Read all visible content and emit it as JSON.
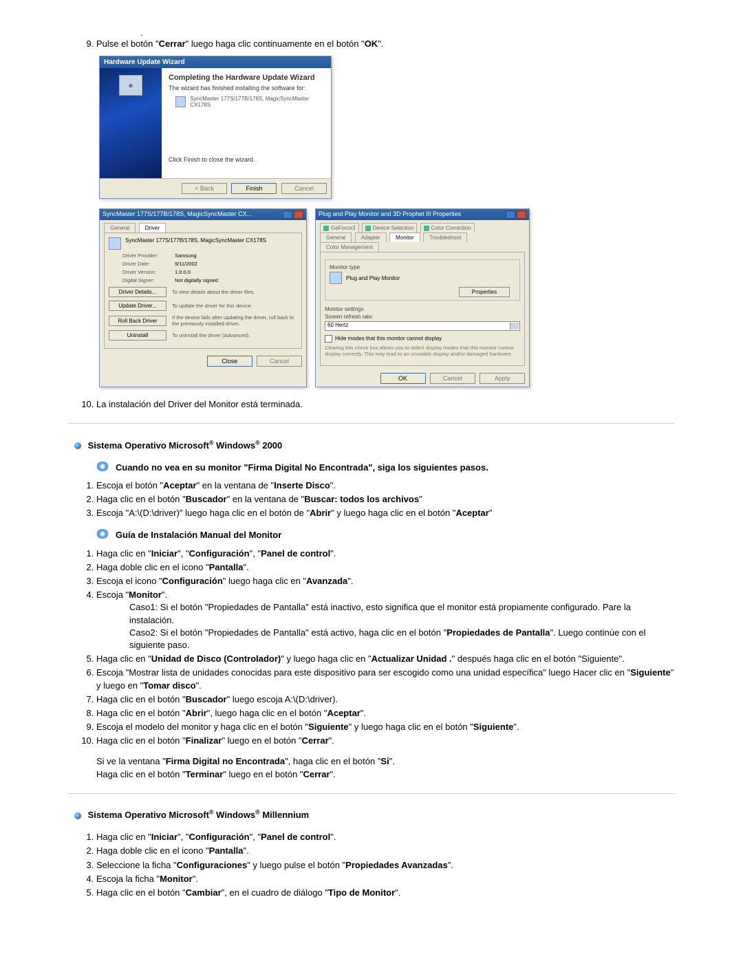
{
  "step9_lead": "Pulse el botón \"",
  "step9_b1": "Cerrar",
  "step9_mid": "\" luego haga clic continuamente en el botón \"",
  "step9_b2": "OK",
  "step9_end": "\".",
  "wizard": {
    "title": "Hardware Update Wizard",
    "heading": "Completing the Hardware Update Wizard",
    "line1": "The wizard has finished installing the software for:",
    "device": "SyncMaster 177S/177B/178S, MagicSyncMaster CX178S",
    "line2": "Click Finish to close the wizard.",
    "back": "< Back",
    "finish": "Finish",
    "cancel": "Cancel"
  },
  "dlg1": {
    "title": "SyncMaster 177S/177B/178S, MagicSyncMaster CX...",
    "tab1": "General",
    "tab2": "Driver",
    "device": "SyncMaster 177S/177B/178S, MagicSyncMaster CX178S",
    "k1": "Driver Provider:",
    "v1": "Samsung",
    "k2": "Driver Date:",
    "v2": "9/11/2002",
    "k3": "Driver Version:",
    "v3": "1.0.0.0",
    "k4": "Digital Signer:",
    "v4": "Not digitally signed",
    "b1": "Driver Details...",
    "d1": "To view details about the driver files.",
    "b2": "Update Driver...",
    "d2": "To update the driver for this device.",
    "b3": "Roll Back Driver",
    "d3": "If the device fails after updating the driver, roll back to the previously installed driver.",
    "b4": "Uninstall",
    "d4": "To uninstall the driver (Advanced).",
    "close": "Close",
    "cancel": "Cancel"
  },
  "dlg2": {
    "title": "Plug and Play Monitor and 3D Prophet III Properties",
    "tabsA": [
      "GeForce3",
      "Device Selection",
      "Color Correction"
    ],
    "tabsB": [
      "General",
      "Adapter",
      "Monitor",
      "Troubleshoot",
      "Color Management"
    ],
    "montype": "Monitor type",
    "monname": "Plug and Play Monitor",
    "props": "Properties",
    "monset": "Monitor settings",
    "refresh": "Screen refresh rate:",
    "hz": "60 Hertz",
    "chk": "Hide modes that this monitor cannot display",
    "note": "Clearing this check box allows you to select display modes that this monitor cannot display correctly. This may lead to an unusable display and/or damaged hardware.",
    "ok": "OK",
    "cancel": "Cancel",
    "apply": "Apply"
  },
  "step10": "La instalación del Driver del Monitor está terminada.",
  "sec2000_pre": "Sistema Operativo Microsoft",
  "sec2000_mid": " Windows",
  "sec2000_end": " 2000",
  "w2000_sub1": "Cuando no vea en su monitor \"Firma Digital No Encontrada\", siga los siguientes pasos.",
  "w2000_a": {
    "l1a": "Escoja el botón \"",
    "l1b": "Aceptar",
    "l1c": "\" en la ventana de \"",
    "l1d": "Inserte Disco",
    "l1e": "\".",
    "l2a": "Haga clic en el botón \"",
    "l2b": "Buscador",
    "l2c": "\" en la ventana de \"",
    "l2d": "Buscar: todos los archivos",
    "l2e": "\"",
    "l3a": "Escoja \"A:\\(D:\\driver)\" luego haga clic en el botón de \"",
    "l3b": "Abrir",
    "l3c": "\" y luego haga clic en el botón \"",
    "l3d": "Aceptar",
    "l3e": "\""
  },
  "w2000_sub2": "Guía de Instalación Manual del Monitor",
  "w2000_b": {
    "l1a": "Haga clic en \"",
    "l1b": "Iniciar",
    "l1c": "\", \"",
    "l1d": "Configuración",
    "l1e": "\", \"",
    "l1f": "Panel de control",
    "l1g": "\".",
    "l2a": "Haga doble clic en el icono \"",
    "l2b": "Pantalla",
    "l2c": "\".",
    "l3a": "Escoja el icono \"",
    "l3b": "Configuración",
    "l3c": "\" luego haga clic en \"",
    "l3d": "Avanzada",
    "l3e": "\".",
    "l4a": "Escoja \"",
    "l4b": "Monitor",
    "l4c": "\".",
    "c1": "Caso1: Si el botón \"Propiedades de Pantalla\" está inactivo, esto significa que el monitor está propiamente configurado. Pare la instalación.",
    "c2a": "Caso2: Si el botón \"Propiedades de Pantalla\" está activo, haga clic en el botón \"",
    "c2b": "Propiedades de Pantalla",
    "c2c": "\". Luego continúe con el siguiente paso.",
    "l5a": "Haga clic en \"",
    "l5b": "Unidad de Disco (Controlador)",
    "l5c": "\" y luego haga clic en \"",
    "l5d": "Actualizar Unidad .",
    "l5e": "\" después haga clic en el botón \"Siguiente\".",
    "l6a": "Escoja \"Mostrar lista de unidades conocidas para este dispositivo para ser escogido como una unidad específica\" luego Hacer clic en \"",
    "l6b": "Siguiente",
    "l6c": "\" y luego en \"",
    "l6d": "Tomar disco",
    "l6e": "\".",
    "l7a": "Haga clic en el botón \"",
    "l7b": "Buscador",
    "l7c": "\" luego escoja A:\\(D:\\driver).",
    "l8a": "Haga clic en el botón \"",
    "l8b": "Abrir",
    "l8c": "\", luego haga clic en el botón \"",
    "l8d": "Aceptar",
    "l8e": "\".",
    "l9a": "Escoja el modelo del monitor y haga clic en el botón \"",
    "l9b": "Siguiente",
    "l9c": "\" y luego haga clic en el botón \"",
    "l9d": "Siguiente",
    "l9e": "\".",
    "l10a": "Haga clic en el botón \"",
    "l10b": "Finalizar",
    "l10c": "\" luego en el botón \"",
    "l10d": "Cerrar",
    "l10e": "\".",
    "p1a": "Si ve la ventana \"",
    "p1b": "Firma Digital no Encontrada",
    "p1c": "\", haga clic en el botón \"",
    "p1d": "Si",
    "p1e": "\".",
    "p2a": "Haga clic en el botón \"",
    "p2b": "Terminar",
    "p2c": "\" luego en el botón \"",
    "p2d": "Cerrar",
    "p2e": "\"."
  },
  "secME_pre": "Sistema Operativo Microsoft",
  "secME_mid": " Windows",
  "secME_end": " Millennium",
  "wme": {
    "l1a": "Haga clic en \"",
    "l1b": "Iniciar",
    "l1c": "\", \"",
    "l1d": "Configuración",
    "l1e": "\", \"",
    "l1f": "Panel de control",
    "l1g": "\".",
    "l2a": "Haga doble clic en el icono \"",
    "l2b": "Pantalla",
    "l2c": "\".",
    "l3a": "Seleccione la ficha \"",
    "l3b": "Configuraciones",
    "l3c": "\" y luego pulse el botón \"",
    "l3d": "Propiedades Avanzadas",
    "l3e": "\".",
    "l4a": "Escoja la ficha \"",
    "l4b": "Monitor",
    "l4c": "\".",
    "l5a": "Haga clic en el botón \"",
    "l5b": "Cambiar",
    "l5c": "\", en el cuadro de diálogo \"",
    "l5d": "Tipo de Monitor",
    "l5e": "\"."
  }
}
